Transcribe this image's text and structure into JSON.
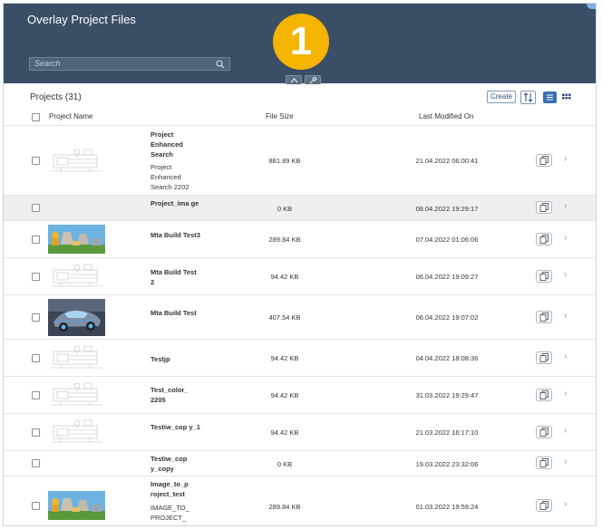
{
  "header": {
    "title": "Overlay Project Files",
    "search_placeholder": "Search",
    "badge": "1",
    "bg_color": "#3a4f66"
  },
  "toolbar": {
    "projects_title": "Projects (31)",
    "create_label": "Create",
    "sort_icon": "sort-icon",
    "list_view_icon": "list-view-icon",
    "grid_view_icon": "grid-view-icon"
  },
  "table": {
    "columns": [
      "Project Name",
      "File Size",
      "Last Modified On"
    ],
    "rows": [
      {
        "name": "Project Enhanced Search",
        "desc": "Project Enhanced Search 2202",
        "size": "881.89 KB",
        "date": "21.04.2022 06:00:41",
        "thumb": "line-drawing"
      },
      {
        "name": "Project_ima ge",
        "desc": "",
        "size": "0 KB",
        "date": "08.04.2022 19:29:17",
        "thumb": "none",
        "selected": true
      },
      {
        "name": "Mta Build Test3",
        "desc": "",
        "size": "289.84 KB",
        "date": "07.04.2022 01:06:06",
        "thumb": "plant-photo"
      },
      {
        "name": "Mta Build Test 2",
        "desc": "",
        "size": "94.42 KB",
        "date": "06.04.2022 19:09:27",
        "thumb": "line-drawing"
      },
      {
        "name": "Mta Build Test",
        "desc": "",
        "size": "407.54 KB",
        "date": "06.04.2022 19:07:02",
        "thumb": "car-render"
      },
      {
        "name": "Testjp",
        "desc": "",
        "size": "94.42 KB",
        "date": "04.04.2022 18:08:36",
        "thumb": "line-drawing"
      },
      {
        "name": "Test_color_ 2205",
        "desc": "",
        "size": "94.42 KB",
        "date": "31.03.2022 19:29:47",
        "thumb": "line-drawing"
      },
      {
        "name": "Testiw_cop y_1",
        "desc": "",
        "size": "94.42 KB",
        "date": "21.03.2022 16:17:10",
        "thumb": "line-drawing"
      },
      {
        "name": "Testiw_cop y_copy",
        "desc": "",
        "size": "0 KB",
        "date": "19.03.2022 23:32:06",
        "thumb": "none"
      },
      {
        "name": "Image_to_p roject_test",
        "desc": "IMAGE_TO_ PROJECT_ TEST",
        "size": "289.84 KB",
        "date": "01.03.2022 19:59:24",
        "thumb": "plant-photo"
      }
    ]
  }
}
